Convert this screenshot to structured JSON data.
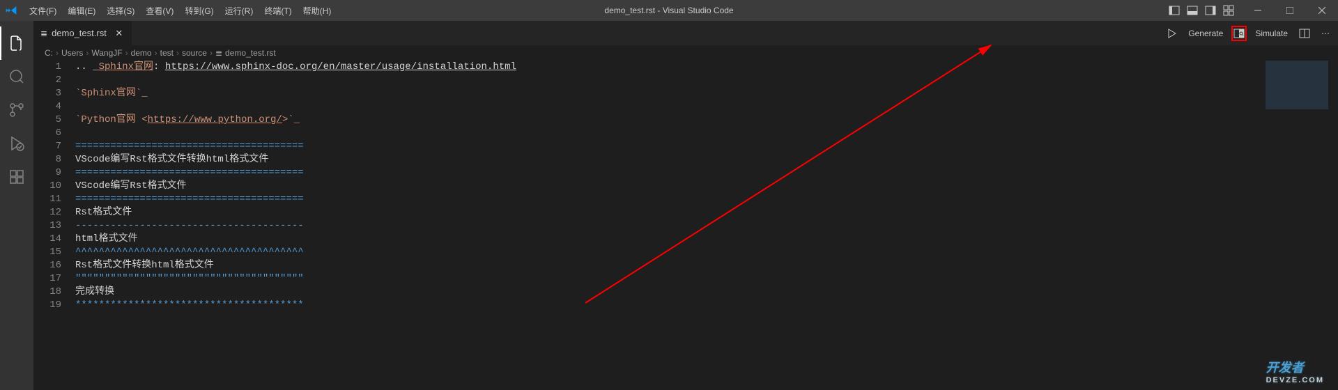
{
  "menubar": {
    "items": [
      "文件(F)",
      "编辑(E)",
      "选择(S)",
      "查看(V)",
      "转到(G)",
      "运行(R)",
      "终端(T)",
      "帮助(H)"
    ]
  },
  "title": "demo_test.rst - Visual Studio Code",
  "tab": {
    "name": "demo_test.rst",
    "icon": "≣"
  },
  "actions": {
    "generate": "Generate",
    "simulate": "Simulate"
  },
  "breadcrumbs": [
    "C:",
    "Users",
    "WangJF",
    "demo",
    "test",
    "source",
    "demo_test.rst"
  ],
  "breadcrumb_icon": "≣",
  "code": {
    "lines": [
      {
        "n": 1,
        "segments": [
          {
            "t": ".. _",
            "c": "white"
          },
          {
            "t": "Sphinx官网",
            "c": "orange",
            "u": true
          },
          {
            "t": ": ",
            "c": "white"
          },
          {
            "t": "https://www.sphinx-doc.org/en/master/usage/installation.html",
            "c": "white",
            "u": true
          }
        ]
      },
      {
        "n": 2,
        "segments": []
      },
      {
        "n": 3,
        "segments": [
          {
            "t": "`Sphinx官网`_",
            "c": "orange"
          }
        ]
      },
      {
        "n": 4,
        "segments": []
      },
      {
        "n": 5,
        "segments": [
          {
            "t": "`Python官网 <",
            "c": "orange"
          },
          {
            "t": "https://www.python.org/",
            "c": "orange",
            "u": true
          },
          {
            "t": ">`_",
            "c": "orange"
          }
        ]
      },
      {
        "n": 6,
        "segments": []
      },
      {
        "n": 7,
        "segments": [
          {
            "t": "=======================================",
            "c": "blue"
          }
        ]
      },
      {
        "n": 8,
        "segments": [
          {
            "t": "VScode编写Rst格式文件转换html格式文件",
            "c": "white"
          }
        ]
      },
      {
        "n": 9,
        "segments": [
          {
            "t": "=======================================",
            "c": "blue"
          }
        ]
      },
      {
        "n": 10,
        "segments": [
          {
            "t": "VScode编写Rst格式文件",
            "c": "white"
          }
        ]
      },
      {
        "n": 11,
        "segments": [
          {
            "t": "=======================================",
            "c": "blue"
          }
        ]
      },
      {
        "n": 12,
        "segments": [
          {
            "t": "Rst格式文件",
            "c": "white"
          }
        ]
      },
      {
        "n": 13,
        "segments": [
          {
            "t": "---------------------------------------",
            "c": "blue"
          }
        ]
      },
      {
        "n": 14,
        "segments": [
          {
            "t": "html格式文件",
            "c": "white"
          }
        ]
      },
      {
        "n": 15,
        "segments": [
          {
            "t": "^^^^^^^^^^^^^^^^^^^^^^^^^^^^^^^^^^^^^^^",
            "c": "blue"
          }
        ]
      },
      {
        "n": 16,
        "segments": [
          {
            "t": "Rst格式文件转换html格式文件",
            "c": "white"
          }
        ]
      },
      {
        "n": 17,
        "segments": [
          {
            "t": "\"\"\"\"\"\"\"\"\"\"\"\"\"\"\"\"\"\"\"\"\"\"\"\"\"\"\"\"\"\"\"\"\"\"\"\"\"\"\"",
            "c": "blue"
          }
        ]
      },
      {
        "n": 18,
        "segments": [
          {
            "t": "完成转换",
            "c": "white"
          }
        ]
      },
      {
        "n": 19,
        "segments": [
          {
            "t": "***************************************",
            "c": "blue"
          }
        ]
      }
    ]
  },
  "watermark": {
    "main": "开发者",
    "sub": "DEVZE.COM"
  }
}
